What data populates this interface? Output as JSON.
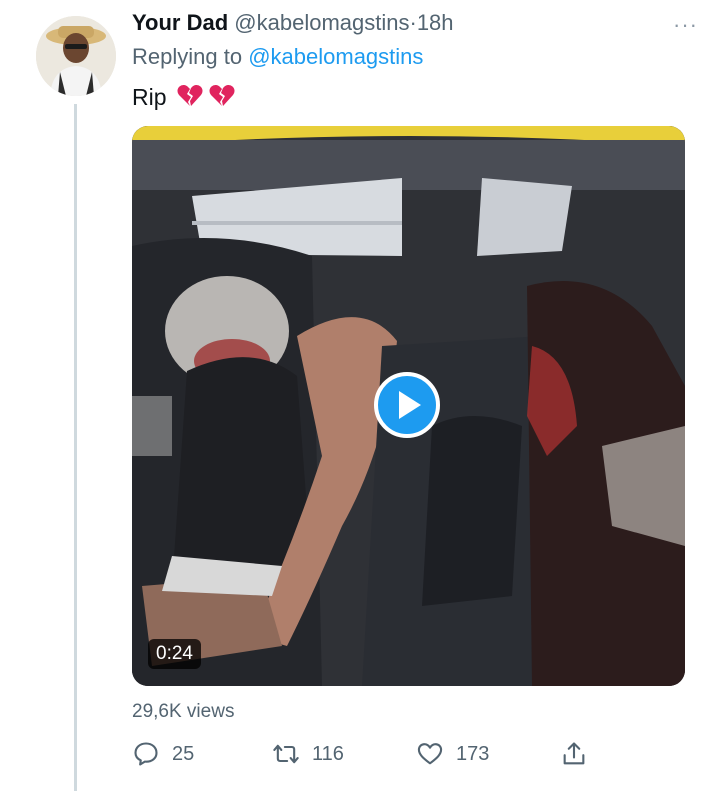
{
  "tweet": {
    "display_name": "Your Dad",
    "handle": "@kabelomagstins",
    "separator": "·",
    "time": "18h",
    "more_label": "···",
    "replying_prefix": "Replying to",
    "replying_handle": "@kabelomagstins",
    "text": "Rip",
    "emojis": [
      "broken-heart-icon",
      "broken-heart-icon"
    ],
    "video": {
      "duration": "0:24",
      "play_icon": "play-icon"
    },
    "views": "29,6K views",
    "actions": {
      "reply_count": "25",
      "retweet_count": "116",
      "like_count": "173",
      "reply_icon": "reply-icon",
      "retweet_icon": "retweet-icon",
      "like_icon": "heart-icon",
      "share_icon": "share-icon"
    }
  },
  "colors": {
    "accent": "#1d9bf0",
    "text_primary": "#0f1419",
    "text_secondary": "#536471",
    "thread_line": "#cfd9de",
    "emoji_red": "#e0245e"
  }
}
